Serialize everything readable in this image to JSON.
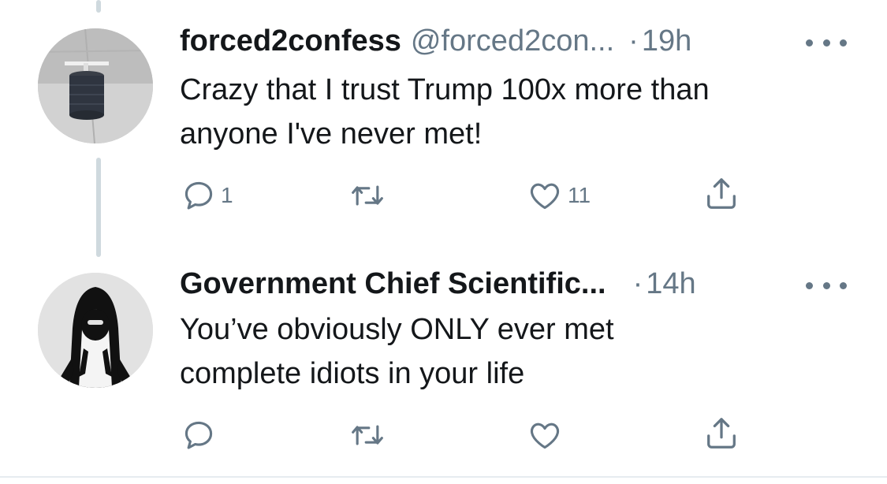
{
  "tweets": [
    {
      "name": "forced2confess",
      "handle": "@forced2con...",
      "dot": "·",
      "time": "19h",
      "text_line1": "Crazy that I trust Trump 100x more than",
      "text_line2": "anyone I've never met!",
      "reply_count": "1",
      "retweet_count": "",
      "like_count": "11"
    },
    {
      "name": "Government Chief Scientific...",
      "handle": "",
      "dot": "·",
      "time": "14h",
      "text_line1": "You’ve obviously ONLY ever met",
      "text_line2": "complete idiots in your life",
      "reply_count": "",
      "retweet_count": "",
      "like_count": ""
    }
  ],
  "colors": {
    "text": "#14171a",
    "secondary": "#657786",
    "thread_line": "#cfd9de"
  },
  "icons": [
    "reply-icon",
    "retweet-icon",
    "like-icon",
    "share-icon",
    "more-icon"
  ]
}
